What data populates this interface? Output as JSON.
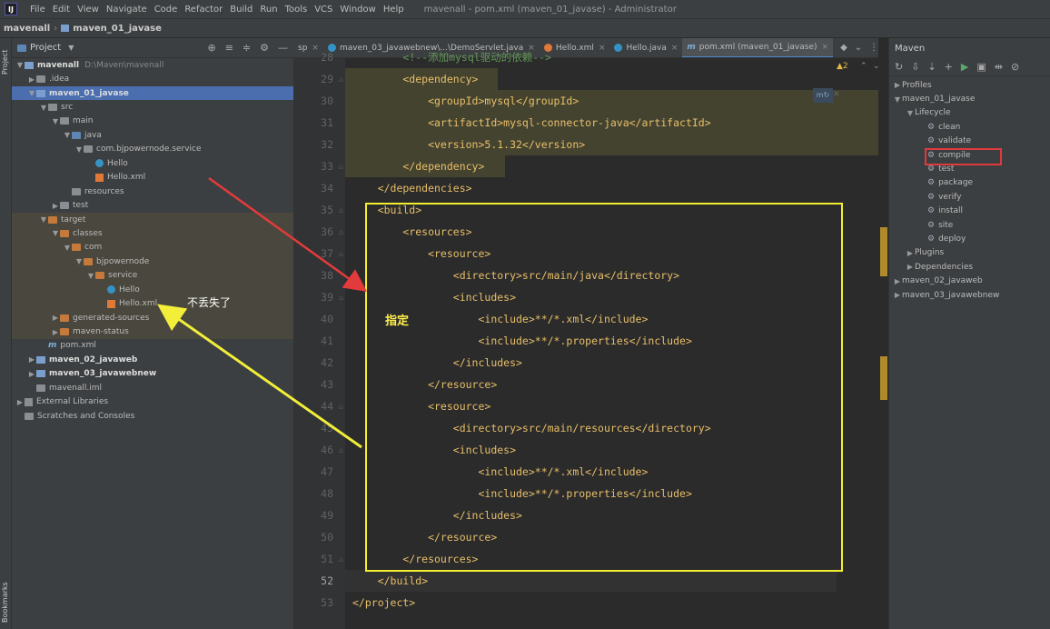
{
  "titlebar": {
    "menus": [
      "File",
      "Edit",
      "View",
      "Navigate",
      "Code",
      "Refactor",
      "Build",
      "Run",
      "Tools",
      "VCS",
      "Window",
      "Help"
    ],
    "window_title": "mavenall - pom.xml (maven_01_javase) - Administrator"
  },
  "navbar": {
    "crumbs": [
      "mavenall",
      "maven_01_javase"
    ]
  },
  "left_strip": {
    "project": "Project",
    "bookmarks": "Bookmarks"
  },
  "project": {
    "header": "Project",
    "tools": [
      "⊕",
      "≡",
      "≑",
      "⚙",
      "—"
    ],
    "rows": [
      {
        "label": "mavenall",
        "extra": "D:\\Maven\\mavenall",
        "bold": true
      },
      {
        "label": ".idea"
      },
      {
        "label": "maven_01_javase",
        "bold": true
      },
      {
        "label": "src"
      },
      {
        "label": "main"
      },
      {
        "label": "java"
      },
      {
        "label": "com.bjpowernode.service"
      },
      {
        "label": "Hello"
      },
      {
        "label": "Hello.xml"
      },
      {
        "label": "resources"
      },
      {
        "label": "test"
      },
      {
        "label": "target"
      },
      {
        "label": "classes"
      },
      {
        "label": "com"
      },
      {
        "label": "bjpowernode"
      },
      {
        "label": "service"
      },
      {
        "label": "Hello"
      },
      {
        "label": "Hello.xml"
      },
      {
        "label": "generated-sources"
      },
      {
        "label": "maven-status"
      },
      {
        "label": "pom.xml"
      },
      {
        "label": "maven_02_javaweb",
        "bold": true
      },
      {
        "label": "maven_03_javawebnew",
        "bold": true
      },
      {
        "label": "mavenall.iml"
      },
      {
        "label": "External Libraries"
      },
      {
        "label": "Scratches and Consoles"
      }
    ]
  },
  "editor": {
    "tabs": [
      {
        "label": "sp",
        "kind": "none"
      },
      {
        "label": "maven_03_javawebnew\\...\\DemoServlet.java",
        "kind": "java"
      },
      {
        "label": "Hello.xml",
        "kind": "xml"
      },
      {
        "label": "Hello.java",
        "kind": "java"
      },
      {
        "label": "pom.xml (maven_01_javase)",
        "kind": "mvn",
        "active": true
      }
    ],
    "warning": "▲2",
    "lines": [
      {
        "n": "28",
        "code": "        <!--添加mysql驱动的依赖-->"
      },
      {
        "n": "29",
        "code": "        <dependency>"
      },
      {
        "n": "30",
        "code": "            <groupId>mysql</groupId>"
      },
      {
        "n": "31",
        "code": "            <artifactId>mysql-connector-java</artifactId>"
      },
      {
        "n": "32",
        "code": "            <version>5.1.32</version>"
      },
      {
        "n": "33",
        "code": "        </dependency>"
      },
      {
        "n": "34",
        "code": "    </dependencies>"
      },
      {
        "n": "35",
        "code": "    <build>"
      },
      {
        "n": "36",
        "code": "        <resources>"
      },
      {
        "n": "37",
        "code": "            <resource>"
      },
      {
        "n": "38",
        "code": "                <directory>src/main/java</directory>"
      },
      {
        "n": "39",
        "code": "                <includes>"
      },
      {
        "n": "40",
        "code": "                    <include>**/*.xml</include>"
      },
      {
        "n": "41",
        "code": "                    <include>**/*.properties</include>"
      },
      {
        "n": "42",
        "code": "                </includes>"
      },
      {
        "n": "43",
        "code": "            </resource>"
      },
      {
        "n": "44",
        "code": "            <resource>"
      },
      {
        "n": "45",
        "code": "                <directory>src/main/resources</directory>"
      },
      {
        "n": "46",
        "code": "                <includes>"
      },
      {
        "n": "47",
        "code": "                    <include>**/*.xml</include>"
      },
      {
        "n": "48",
        "code": "                    <include>**/*.properties</include>"
      },
      {
        "n": "49",
        "code": "                </includes>"
      },
      {
        "n": "50",
        "code": "            </resource>"
      },
      {
        "n": "51",
        "code": "        </resources>"
      },
      {
        "n": "52",
        "code": "    </build>"
      },
      {
        "n": "53",
        "code": "</project>"
      }
    ]
  },
  "maven": {
    "header": "Maven",
    "tools": [
      "↻",
      "⇩",
      "⇣",
      "+",
      "▶",
      "▣",
      "⇹",
      "⊘"
    ],
    "rows": [
      {
        "label": "Profiles",
        "level": 0
      },
      {
        "label": "maven_01_javase",
        "level": 0
      },
      {
        "label": "Lifecycle",
        "level": 1
      },
      {
        "label": "clean",
        "level": 2
      },
      {
        "label": "validate",
        "level": 2
      },
      {
        "label": "compile",
        "level": 2,
        "boxed": true
      },
      {
        "label": "test",
        "level": 2
      },
      {
        "label": "package",
        "level": 2
      },
      {
        "label": "verify",
        "level": 2
      },
      {
        "label": "install",
        "level": 2
      },
      {
        "label": "site",
        "level": 2
      },
      {
        "label": "deploy",
        "level": 2
      },
      {
        "label": "Plugins",
        "level": 1
      },
      {
        "label": "Dependencies",
        "level": 1
      },
      {
        "label": "maven_02_javaweb",
        "level": 0
      },
      {
        "label": "maven_03_javawebnew",
        "level": 0
      }
    ]
  },
  "annotations": {
    "not_lost": "不丢失了",
    "specify": "指定",
    "colors": {
      "red": "#e23b3b",
      "yellow": "#f2ee3a",
      "box": "#f4ee2e",
      "maven_box": "#e0393e"
    }
  }
}
